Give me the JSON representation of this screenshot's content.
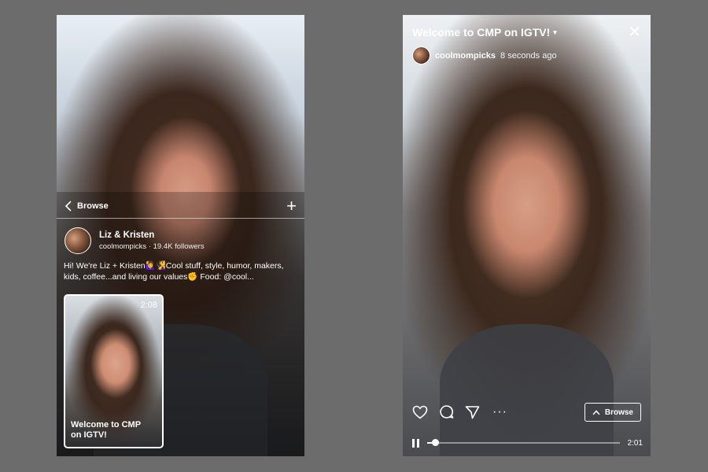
{
  "left": {
    "browse_label": "Browse",
    "plus_label": "+",
    "profile": {
      "name": "Liz & Kristen",
      "handle_followers": "coolmompicks · 19.4K followers"
    },
    "bio": "Hi! We're Liz + Kristen🙋‍♀️🧏‍♀️Cool stuff, style, humor, makers, kids, coffee...and living our values✊ Food: @cool...",
    "thumbnail": {
      "duration": "2:08",
      "title": "Welcome to CMP on IGTV!"
    }
  },
  "right": {
    "title": "Welcome to CMP on IGTV!",
    "caret": "▾",
    "close": "✕",
    "owner": "coolmompicks",
    "timestamp": "8 seconds ago",
    "more": "···",
    "browse_label": "Browse",
    "time_remaining": "2:01",
    "progress": 0.04
  },
  "icons": [
    "chevron-left-icon",
    "plus-icon",
    "heart-icon",
    "comment-icon",
    "share-icon",
    "more-icon",
    "chevron-up-icon",
    "pause-icon",
    "close-icon"
  ],
  "colors": {
    "page_bg": "#6c6c6c",
    "text": "#ffffff"
  }
}
